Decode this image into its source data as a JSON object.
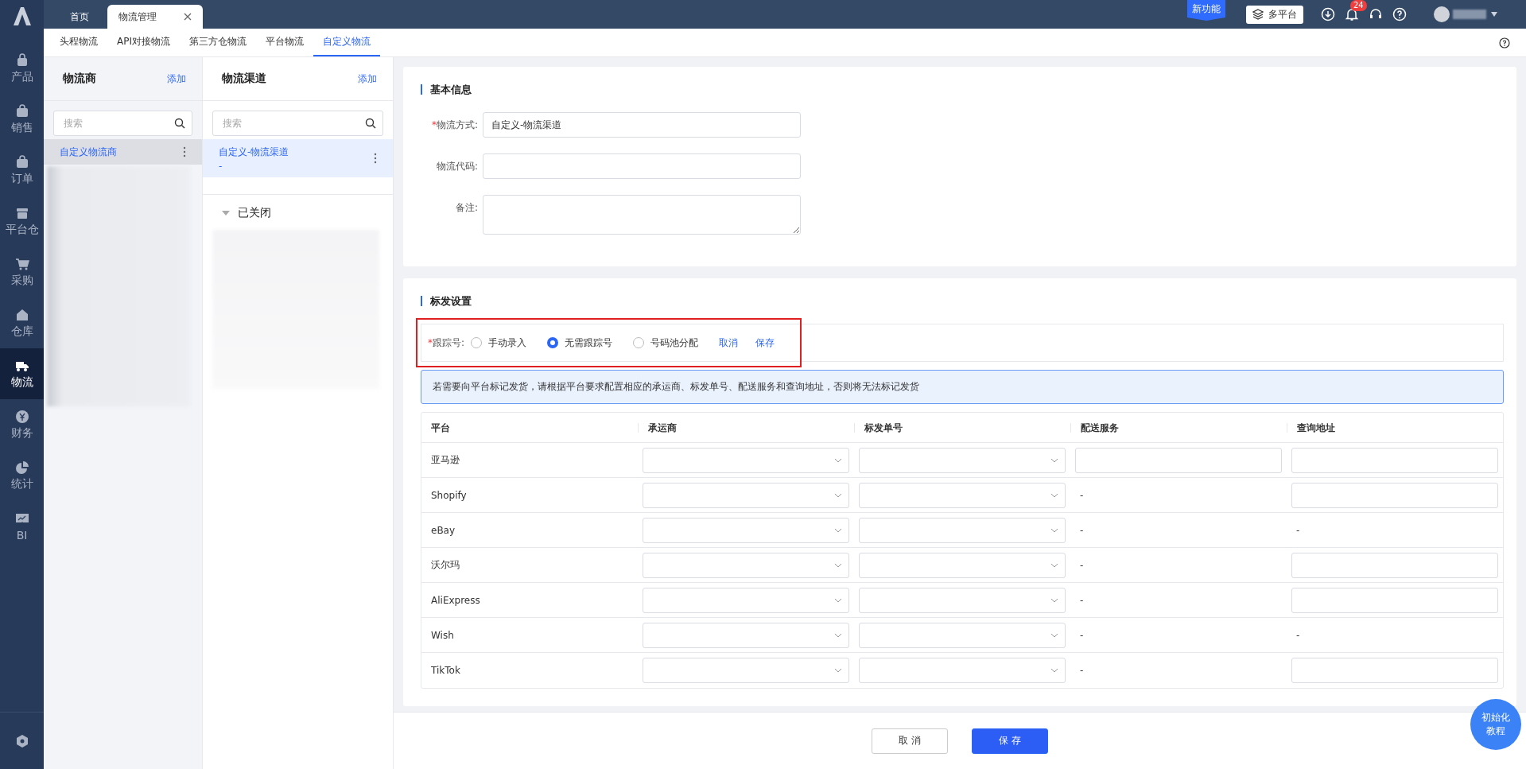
{
  "nav": {
    "items": [
      {
        "label": "产品",
        "selected": false
      },
      {
        "label": "销售",
        "selected": false
      },
      {
        "label": "订单",
        "selected": false
      },
      {
        "label": "平台仓",
        "selected": false
      },
      {
        "label": "采购",
        "selected": false
      },
      {
        "label": "仓库",
        "selected": false
      },
      {
        "label": "物流",
        "selected": true
      },
      {
        "label": "财务",
        "selected": false
      },
      {
        "label": "统计",
        "selected": false
      },
      {
        "label": "BI",
        "selected": false
      }
    ]
  },
  "page_tabs": [
    {
      "label": "首页",
      "selected": false,
      "closable": false
    },
    {
      "label": "物流管理",
      "selected": true,
      "closable": true
    }
  ],
  "header": {
    "new_feature": "新功能",
    "platform_button": "多平台",
    "notification_count": "24"
  },
  "sub_tabs": [
    {
      "label": "头程物流",
      "selected": false
    },
    {
      "label": "API对接物流",
      "selected": false
    },
    {
      "label": "第三方仓物流",
      "selected": false
    },
    {
      "label": "平台物流",
      "selected": false
    },
    {
      "label": "自定义物流",
      "selected": true
    }
  ],
  "providers": {
    "title": "物流商",
    "add": "添加",
    "search_placeholder": "搜索",
    "items": [
      {
        "name": "自定义物流商",
        "selected": true
      }
    ]
  },
  "channels": {
    "title": "物流渠道",
    "add": "添加",
    "search_placeholder": "搜索",
    "items": [
      {
        "name": "自定义-物流渠道",
        "sub": "-",
        "selected": true
      }
    ],
    "closed_group": {
      "label": "已关闭",
      "expanded": true
    }
  },
  "basic_info": {
    "title": "基本信息",
    "fields": [
      {
        "label": "物流方式:",
        "required_mark": "*",
        "kind": "input",
        "value": "自定义-物流渠道"
      },
      {
        "label": "物流代码:",
        "kind": "input"
      },
      {
        "label": "备注:",
        "kind": "textarea"
      }
    ]
  },
  "marking": {
    "title": "标发设置",
    "tracking": {
      "label": "跟踪号:",
      "required_mark": "*",
      "options": [
        {
          "label": "手动录入",
          "selected": false
        },
        {
          "label": "无需跟踪号",
          "selected": true
        },
        {
          "label": "号码池分配",
          "selected": false
        }
      ],
      "cancel": "取消",
      "save": "保存"
    },
    "notice": "若需要向平台标记发货，请根据平台要求配置相应的承运商、标发单号、配送服务和查询地址，否则将无法标记发货",
    "table": {
      "columns": [
        "平台",
        "承运商",
        "标发单号",
        "配送服务",
        "查询地址"
      ],
      "rows": [
        {
          "cells": [
            {
              "kind": "text",
              "text": "亚马逊"
            },
            {
              "kind": "select"
            },
            {
              "kind": "select"
            },
            {
              "kind": "input"
            },
            {
              "kind": "input"
            }
          ]
        },
        {
          "cells": [
            {
              "kind": "text",
              "text": "Shopify"
            },
            {
              "kind": "select"
            },
            {
              "kind": "select"
            },
            {
              "kind": "text",
              "text": "-"
            },
            {
              "kind": "input"
            }
          ]
        },
        {
          "cells": [
            {
              "kind": "text",
              "text": "eBay"
            },
            {
              "kind": "select"
            },
            {
              "kind": "select"
            },
            {
              "kind": "text",
              "text": "-"
            },
            {
              "kind": "text",
              "text": "-"
            }
          ]
        },
        {
          "cells": [
            {
              "kind": "text",
              "text": "沃尔玛"
            },
            {
              "kind": "select"
            },
            {
              "kind": "select"
            },
            {
              "kind": "text",
              "text": "-"
            },
            {
              "kind": "input"
            }
          ]
        },
        {
          "cells": [
            {
              "kind": "text",
              "text": "AliExpress"
            },
            {
              "kind": "select"
            },
            {
              "kind": "select"
            },
            {
              "kind": "text",
              "text": "-"
            },
            {
              "kind": "input"
            }
          ]
        },
        {
          "cells": [
            {
              "kind": "text",
              "text": "Wish"
            },
            {
              "kind": "select"
            },
            {
              "kind": "select"
            },
            {
              "kind": "text",
              "text": "-"
            },
            {
              "kind": "text",
              "text": "-"
            }
          ]
        },
        {
          "cells": [
            {
              "kind": "text",
              "text": "TikTok"
            },
            {
              "kind": "select"
            },
            {
              "kind": "select"
            },
            {
              "kind": "text",
              "text": "-"
            },
            {
              "kind": "input"
            }
          ]
        }
      ]
    }
  },
  "footer": {
    "cancel": "取 消",
    "save": "保 存"
  },
  "tutorial_button": [
    "初始化",
    "教程"
  ]
}
